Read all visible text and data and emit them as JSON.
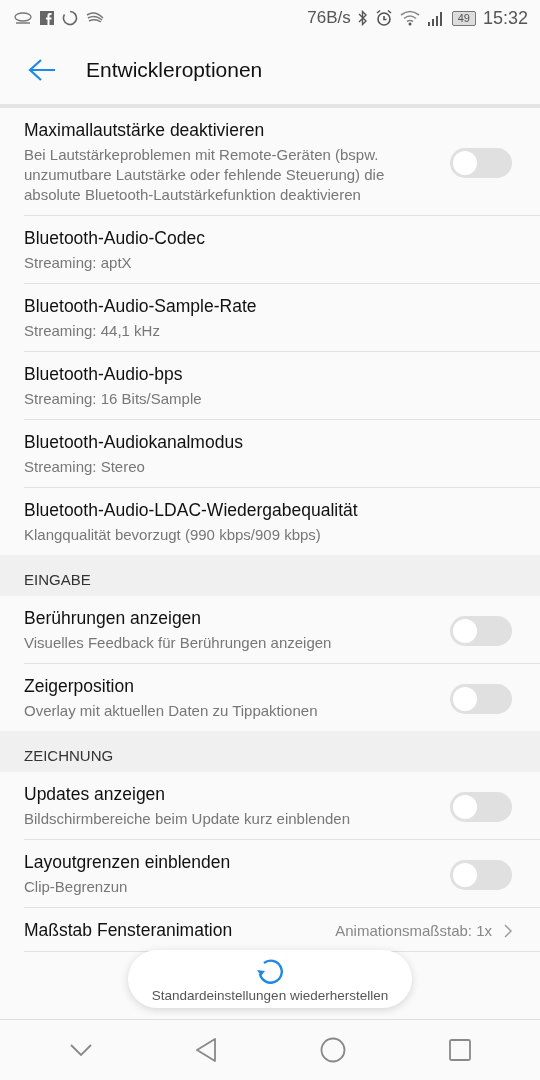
{
  "status_bar": {
    "speed": "76B/s",
    "battery": "49",
    "time": "15:32"
  },
  "app_bar": {
    "title": "Entwickleroptionen"
  },
  "items": [
    {
      "kind": "toggle",
      "title": "Maximallautstärke deaktivieren",
      "subtitle": "Bei Lautstärkeproblemen mit Remote-Geräten (bspw. unzumutbare Lautstärke oder fehlende Steuerung) die absolute Bluetooth-Lautstärkefunktion deaktivieren",
      "on": false
    },
    {
      "kind": "option",
      "title": "Bluetooth-Audio-Codec",
      "subtitle": "Streaming: aptX"
    },
    {
      "kind": "option",
      "title": "Bluetooth-Audio-Sample-Rate",
      "subtitle": "Streaming: 44,1 kHz"
    },
    {
      "kind": "option",
      "title": "Bluetooth-Audio-bps",
      "subtitle": "Streaming: 16 Bits/Sample"
    },
    {
      "kind": "option",
      "title": "Bluetooth-Audiokanalmodus",
      "subtitle": "Streaming: Stereo"
    },
    {
      "kind": "option",
      "title": "Bluetooth-Audio-LDAC-Wiedergabequalität",
      "subtitle": "Klangqualität bevorzugt (990 kbps/909 kbps)"
    },
    {
      "kind": "header",
      "title": "EINGABE"
    },
    {
      "kind": "toggle",
      "title": "Berührungen anzeigen",
      "subtitle": "Visuelles Feedback für Berührungen anzeigen",
      "on": false
    },
    {
      "kind": "toggle",
      "title": "Zeigerposition",
      "subtitle": "Overlay mit aktuellen Daten zu Tippaktionen",
      "on": false
    },
    {
      "kind": "header",
      "title": "ZEICHNUNG"
    },
    {
      "kind": "toggle",
      "title": "Updates anzeigen",
      "subtitle": "Bildschirmbereiche beim Update kurz einblenden",
      "on": false
    },
    {
      "kind": "toggle",
      "title": "Layoutgrenzen einblenden",
      "subtitle": "Clip-Begrenzun",
      "on": false
    },
    {
      "kind": "value",
      "title": "Maßstab Fensteranimation",
      "value": "Animationsmaßstab: 1x"
    }
  ],
  "toast": {
    "text": "Standardeinstellungen wiederherstellen"
  }
}
